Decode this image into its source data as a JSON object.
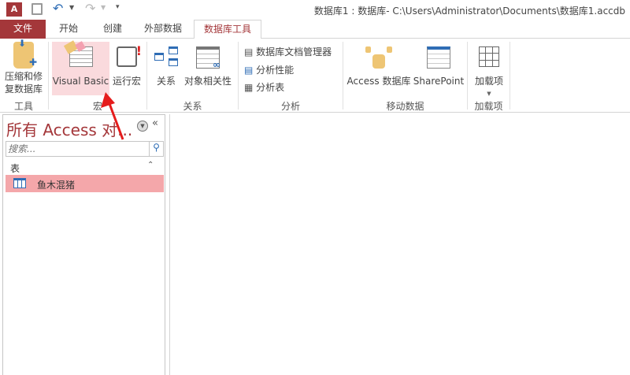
{
  "window": {
    "title": "数据库1 : 数据库- C:\\Users\\Administrator\\Documents\\数据库1.accdb"
  },
  "tabs": [
    {
      "label": "文件"
    },
    {
      "label": "开始"
    },
    {
      "label": "创建"
    },
    {
      "label": "外部数据"
    },
    {
      "label": "数据库工具",
      "active": true
    }
  ],
  "ribbon": {
    "tools": {
      "compact_repair": "压缩和修\n复数据库",
      "compact_line1": "压缩和修",
      "compact_line2": "复数据库",
      "group": "工具"
    },
    "macro": {
      "visual_basic": "Visual Basic",
      "run_macro": "运行宏",
      "group": "宏"
    },
    "relationships": {
      "relationships": "关系",
      "object_dependencies": "对象相关性",
      "group": "关系"
    },
    "analyze": {
      "documenter": "数据库文档管理器",
      "performance": "分析性能",
      "table": "分析表",
      "group": "分析"
    },
    "move_data": {
      "access_db": "Access 数据库",
      "sharepoint": "SharePoint",
      "group": "移动数据"
    },
    "addins": {
      "addins": "加载项",
      "group": "加载项"
    }
  },
  "nav": {
    "title": "所有 Access 对...",
    "search_placeholder": "搜索...",
    "section": "表",
    "items": [
      {
        "label": "鱼木混猪",
        "selected": true
      }
    ]
  },
  "colors": {
    "accent": "#a4373a",
    "selected": "#f4a7aa",
    "highlight": "#fadadd",
    "arrow": "#e51c1c"
  }
}
